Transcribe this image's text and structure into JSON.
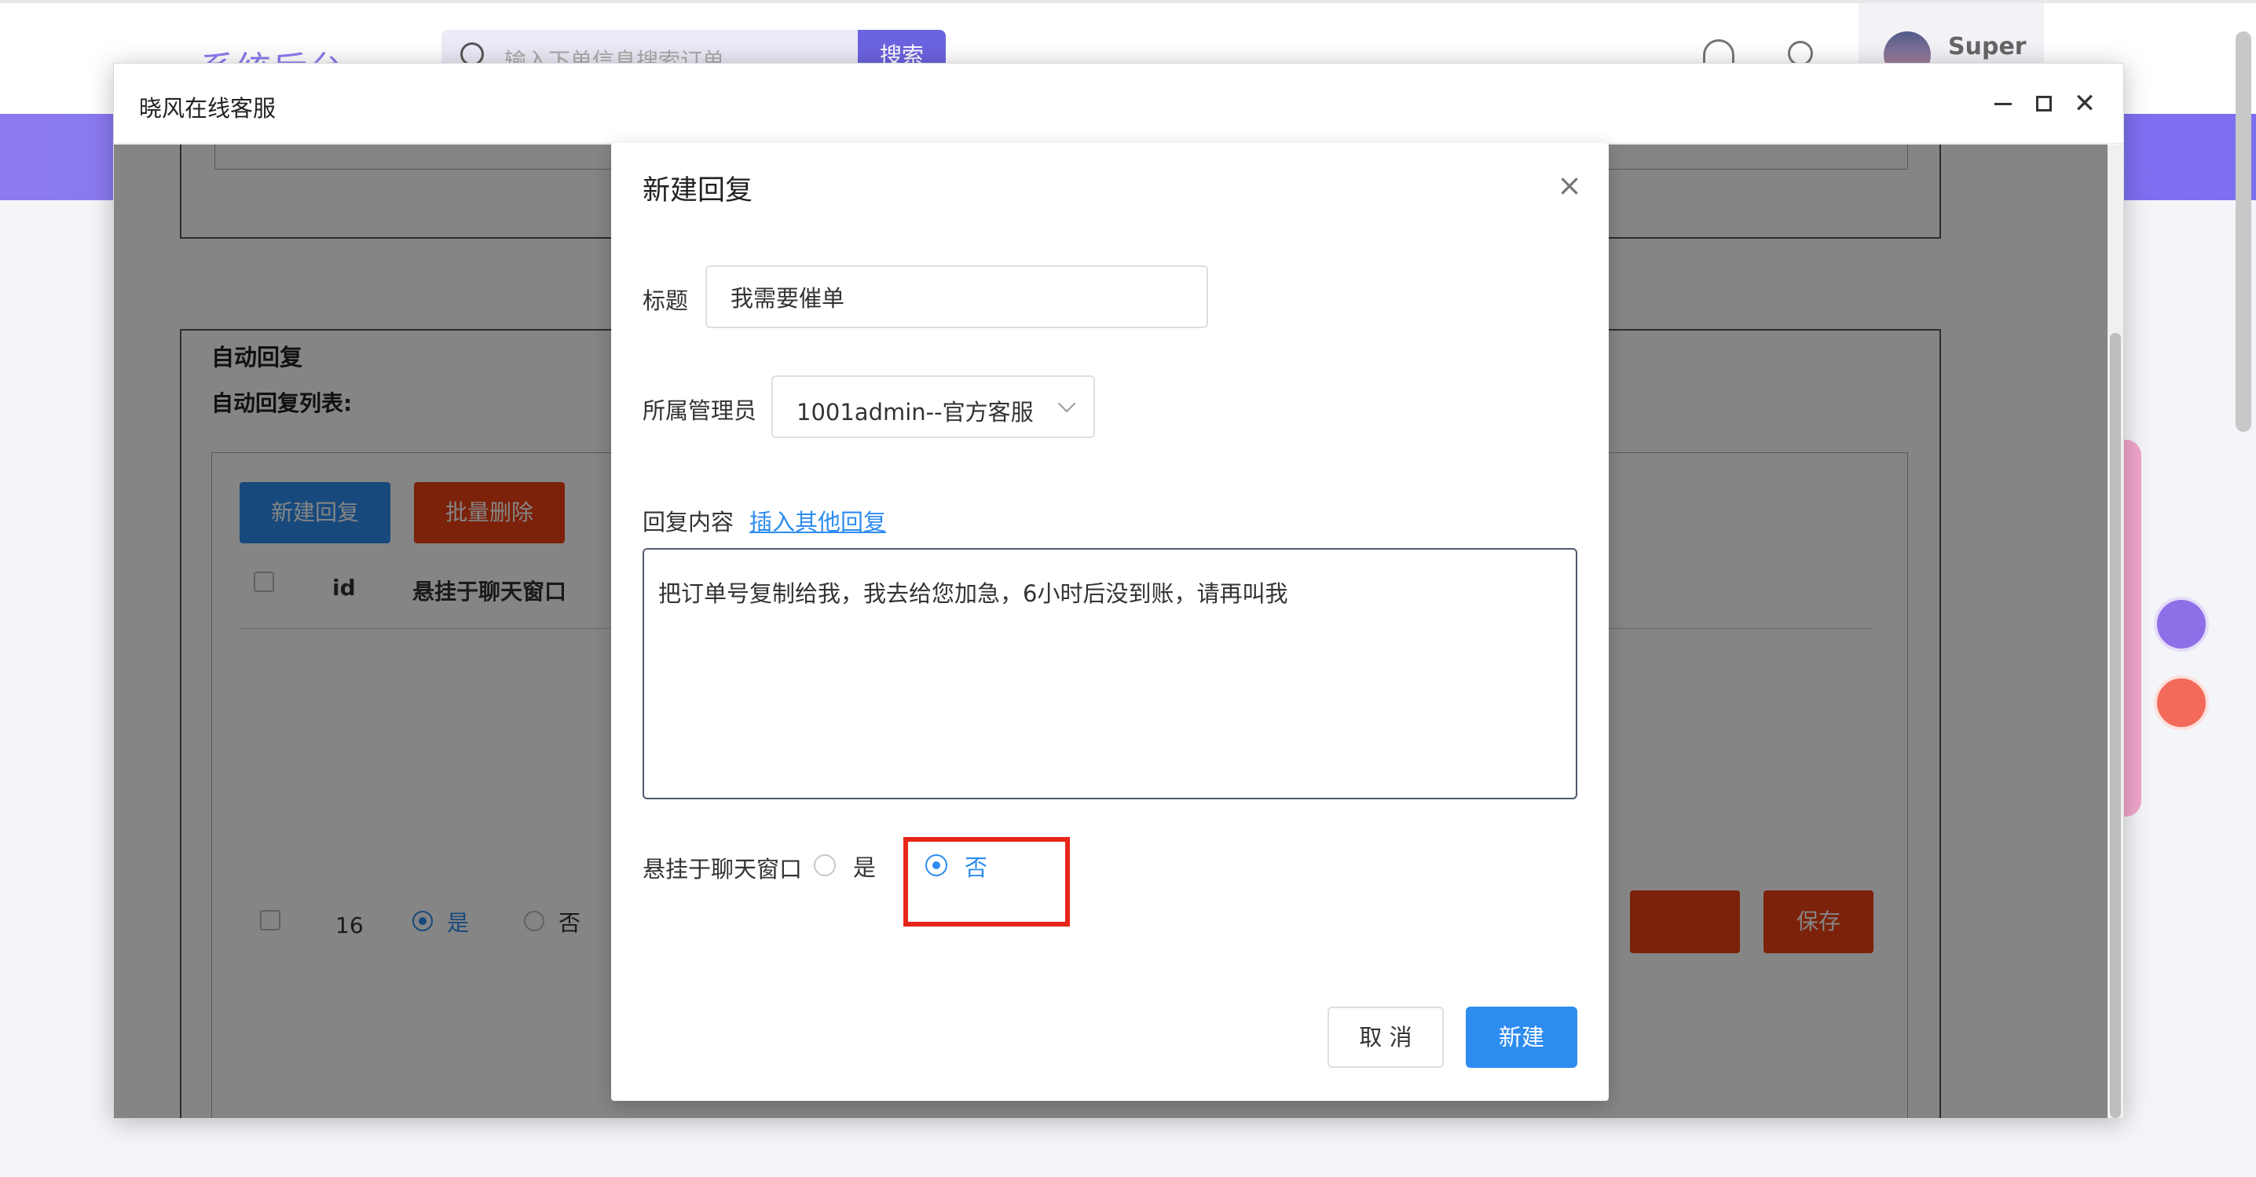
{
  "background_app": {
    "logo": "系统后台",
    "search_placeholder": "输入下单信息搜索订单",
    "search_button": "搜索",
    "username": "Super"
  },
  "window": {
    "title": "晓风在线客服"
  },
  "page": {
    "section_title": "自动回复",
    "list_title": "自动回复列表:",
    "new_reply_button": "新建回复",
    "batch_delete_button": "批量删除",
    "columns": [
      "id",
      "悬挂于聊天窗口"
    ],
    "rows": [
      {
        "id": "16",
        "pin_yes": "是",
        "pin_no": "否",
        "pin_selected": "是"
      }
    ],
    "save_button": "保存"
  },
  "modal": {
    "title": "新建回复",
    "title_label": "标题",
    "title_value": "我需要催单",
    "admin_label": "所属管理员",
    "admin_value": "1001admin--官方客服",
    "content_label": "回复内容",
    "insert_link": "插入其他回复",
    "content_value": "把订单号复制给我，我去给您加急，6小时后没到账，请再叫我",
    "pin_label": "悬挂于聊天窗口",
    "pin_yes": "是",
    "pin_no": "否",
    "pin_selected": "否",
    "cancel_button": "取 消",
    "create_button": "新建"
  },
  "colors": {
    "primary": "#2d8cf0",
    "danger": "#ed4014",
    "highlight": "#e8251a",
    "banner": "#8b7af0"
  }
}
